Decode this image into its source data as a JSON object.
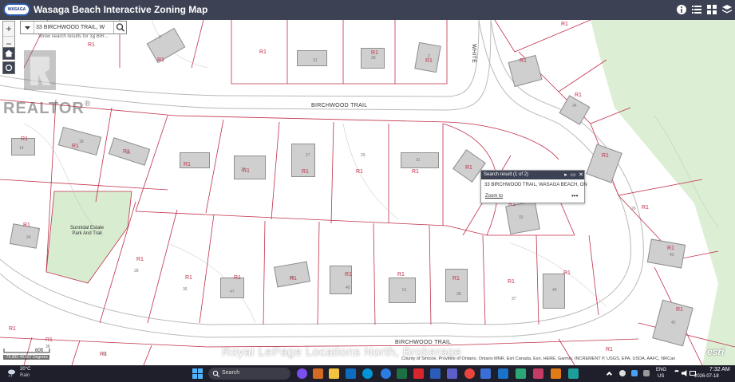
{
  "app": {
    "logo_text": "WASAGA",
    "title": "Wasaga Beach Interactive Zoning Map"
  },
  "search": {
    "value": "33 BIRCHWOOD TRAIL, W",
    "hint": "Show search results for 33 BIR..."
  },
  "overlay": {
    "realtor": "REALTOR",
    "registered": "®",
    "watermark": "Royal LePage Locations North, Brokerage"
  },
  "popup": {
    "title": "Search result (1 of 2)",
    "address": "33 BIRCHWOOD TRAIL, WASAGA BEACH, ON",
    "zoom_link": "Zoom to",
    "more": "•••"
  },
  "map": {
    "zone_code": "R1",
    "streets": [
      "BIRCHWOOD TRAIL",
      "BIRCHWOOD TRAIL",
      "WHITE"
    ],
    "park_label_line1": "Sunnidal Estate",
    "park_label_line2": "Park And Trail",
    "lot_numbers": [
      "2",
      "3",
      "31",
      "28",
      "2",
      "34",
      "14",
      "18",
      "21",
      "29",
      "31",
      "27",
      "22",
      "24",
      "33",
      "26",
      "28",
      "43",
      "36",
      "47",
      "45",
      "40",
      "51",
      "38",
      "37",
      "49",
      "42",
      "38",
      "33"
    ],
    "scale_text": "60ft",
    "coordinates": "-79.993 44.567 Degrees",
    "attribution": "County of Simcoe, Province of Ontario, Ontario MNR, Esri Canada, Esri, HERE, Garmin, INCREMENT P, USGS, EPA, USDA, AAFC, NRCan",
    "esri": "esri"
  },
  "taskbar": {
    "weather_temp": "20°C",
    "weather_cond": "Rain",
    "search_label": "Search",
    "lang_top": "ENG",
    "lang_bottom": "US",
    "time": "7:32 AM",
    "date": "2026-07-18"
  },
  "colors": {
    "header": "#3c4254",
    "lot_line": "#c0304a",
    "road": "#b8b8b8",
    "park": "#d8ecd0",
    "taskbar": "#1e1f2b"
  }
}
